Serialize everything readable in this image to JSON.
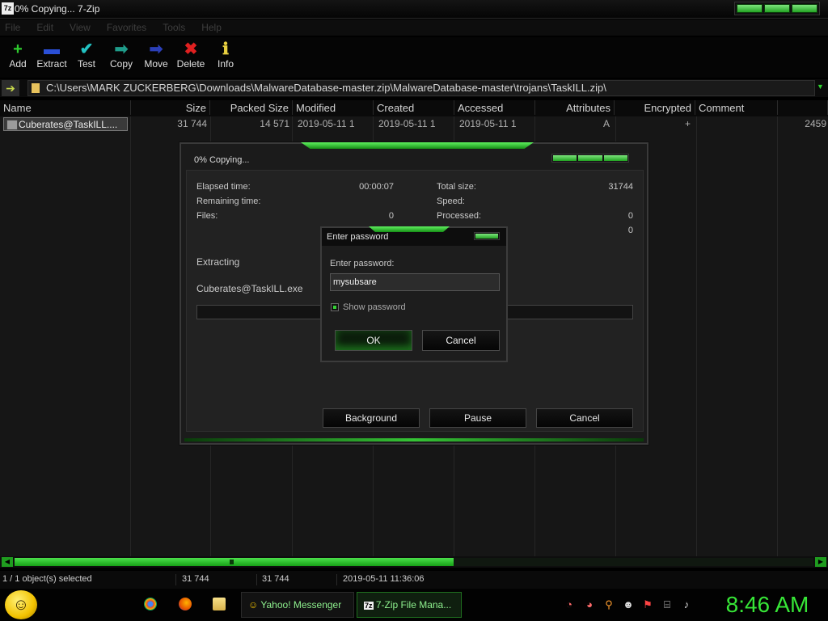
{
  "window": {
    "icon_text": "7z",
    "title": "0% Copying... 7-Zip"
  },
  "menu": [
    "File",
    "Edit",
    "View",
    "Favorites",
    "Tools",
    "Help"
  ],
  "toolbar": [
    {
      "label": "Add",
      "icon": "plus-icon",
      "glyph": "+",
      "color": "#2ecc2e"
    },
    {
      "label": "Extract",
      "icon": "minus-icon",
      "glyph": "▬",
      "color": "#2a4fd6"
    },
    {
      "label": "Test",
      "icon": "check-icon",
      "glyph": "✔",
      "color": "#22c2c2"
    },
    {
      "label": "Copy",
      "icon": "copy-arrow-icon",
      "glyph": "➡",
      "color": "#1f9c8a"
    },
    {
      "label": "Move",
      "icon": "move-arrow-icon",
      "glyph": "➡",
      "color": "#2b3fb8"
    },
    {
      "label": "Delete",
      "icon": "delete-x-icon",
      "glyph": "✖",
      "color": "#e02020"
    },
    {
      "label": "Info",
      "icon": "info-icon",
      "glyph": "ℹ",
      "color": "#e8d040"
    }
  ],
  "address": {
    "path": "C:\\Users\\MARK ZUCKERBERG\\Downloads\\MalwareDatabase-master.zip\\MalwareDatabase-master\\trojans\\TaskILL.zip\\"
  },
  "columns": [
    "Name",
    "Size",
    "Packed Size",
    "Modified",
    "Created",
    "Accessed",
    "Attributes",
    "Encrypted",
    "Comment"
  ],
  "row": {
    "name": "Cuberates@TaskILL....",
    "size": "31 744",
    "packed": "14 571",
    "modified": "2019-05-11 1",
    "created": "2019-05-11 1",
    "accessed": "2019-05-11 1",
    "attributes": "A",
    "encrypted": "+",
    "trailing": "2459"
  },
  "scroll": {
    "position_fraction": 0.55
  },
  "status": {
    "selected": "1 / 1 object(s) selected",
    "size": "31 744",
    "packed": "31 744",
    "date": "2019-05-11 11:36:06"
  },
  "taskbar": {
    "yahoo": "Yahoo! Messenger",
    "zip": "7-Zip File Mana...",
    "zip_icon_text": "7z",
    "clock": "8:46 AM"
  },
  "copy_dialog": {
    "title": "0% Copying...",
    "elapsed_label": "Elapsed time:",
    "elapsed_value": "00:00:07",
    "remaining_label": "Remaining time:",
    "files_label": "Files:",
    "files_value": "0",
    "total_label": "Total size:",
    "total_value": "31744",
    "speed_label": "Speed:",
    "processed_label": "Processed:",
    "processed_value": "0",
    "extra_value": "0",
    "action": "Extracting",
    "file": "Cuberates@TaskILL.exe",
    "progress_fraction": 0.0,
    "buttons": {
      "background": "Background",
      "pause": "Pause",
      "cancel": "Cancel"
    }
  },
  "password_dialog": {
    "title": "Enter password",
    "label": "Enter password:",
    "value": "mysubsare",
    "show_password_label": "Show password",
    "show_password_checked": true,
    "ok": "OK",
    "cancel": "Cancel"
  },
  "colors": {
    "accent": "#2ecc2e",
    "background": "#000000"
  }
}
